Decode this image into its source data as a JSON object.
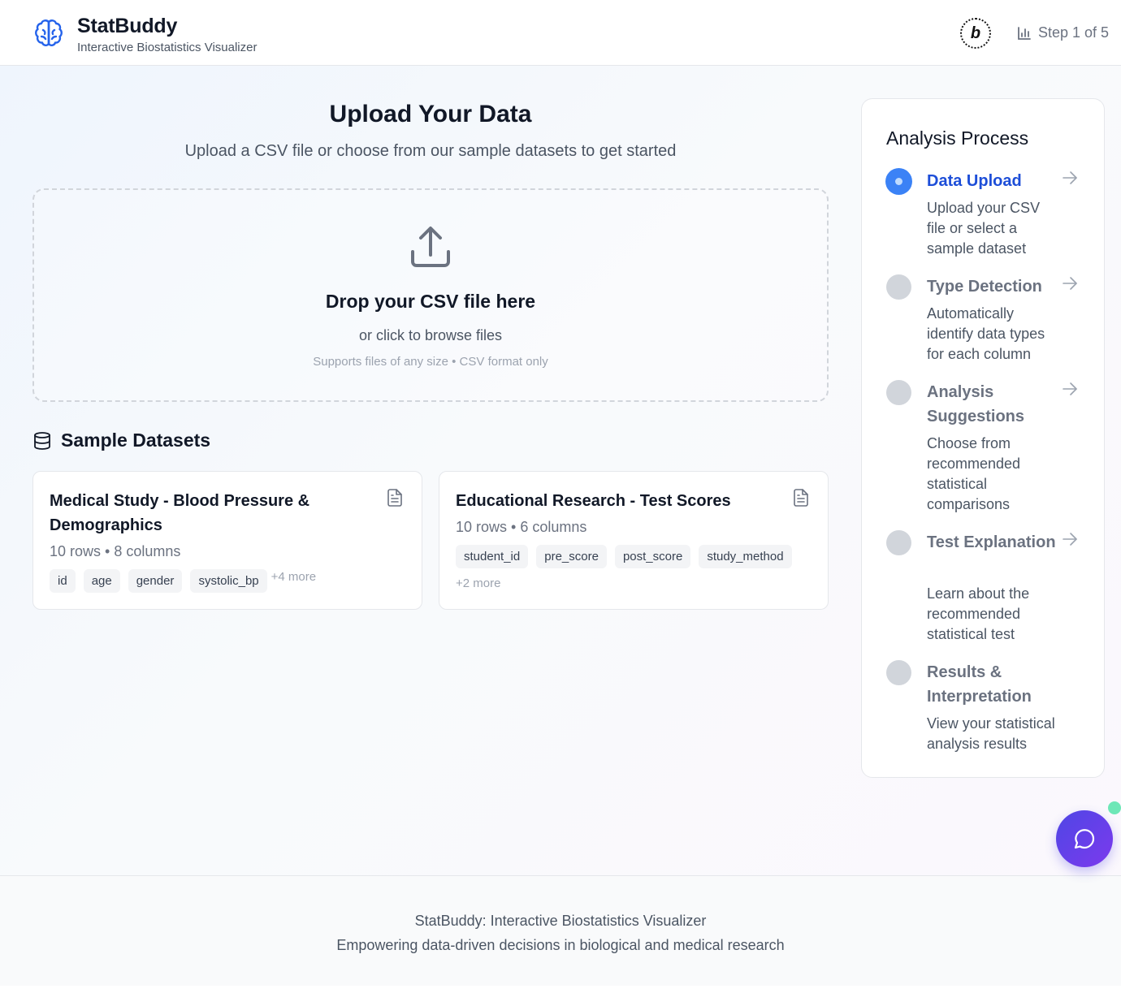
{
  "header": {
    "title": "StatBuddy",
    "subtitle": "Interactive Biostatistics Visualizer",
    "badge_letter": "b",
    "step_label": "Step 1 of 5"
  },
  "upload": {
    "title": "Upload Your Data",
    "subtitle": "Upload a CSV file or choose from our sample datasets to get started",
    "dropzone_title": "Drop your CSV file here",
    "dropzone_sub": "or click to browse files",
    "dropzone_note": "Supports files of any size • CSV format only"
  },
  "samples": {
    "title": "Sample Datasets",
    "cards": [
      {
        "title": "Medical Study - Blood Pressure & Demographics",
        "meta": "10 rows • 8 columns",
        "tags": [
          "id",
          "age",
          "gender",
          "systolic_bp"
        ],
        "more": "+4 more"
      },
      {
        "title": "Educational Research - Test Scores",
        "meta": "10 rows • 6 columns",
        "tags": [
          "student_id",
          "pre_score",
          "post_score",
          "study_method"
        ],
        "more": "+2 more"
      }
    ]
  },
  "process": {
    "title": "Analysis Process",
    "steps": [
      {
        "title": "Data Upload",
        "desc": "Upload your CSV file or select a sample dataset",
        "active": true
      },
      {
        "title": "Type Detection",
        "desc": "Automatically identify data types for each column",
        "active": false
      },
      {
        "title": "Analysis Suggestions",
        "desc": "Choose from recommended statistical comparisons",
        "active": false
      },
      {
        "title": "Test Explanation",
        "desc": "Learn about the recommended statistical test",
        "active": false
      },
      {
        "title": "Results & Interpretation",
        "desc": "View your statistical analysis results",
        "active": false
      }
    ]
  },
  "footer": {
    "line1": "StatBuddy: Interactive Biostatistics Visualizer",
    "line2": "Empowering data-driven decisions in biological and medical research"
  },
  "colors": {
    "accent": "#3b82f6",
    "accent_text": "#1d4ed8",
    "fab_start": "#4f46e5",
    "fab_end": "#7c3aed",
    "online": "#6ee7b7"
  },
  "icons": {
    "logo": "brain-icon",
    "step": "bar-chart-icon",
    "upload": "upload-icon",
    "database": "database-icon",
    "document": "file-text-icon",
    "arrow": "arrow-right-icon",
    "chat": "message-circle-icon"
  }
}
